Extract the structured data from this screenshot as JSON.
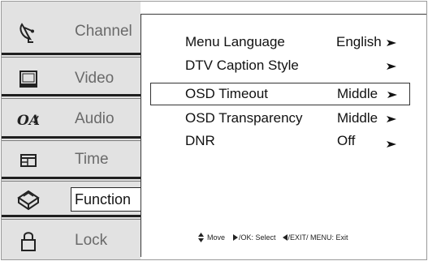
{
  "sidebar": {
    "items": [
      {
        "label": "Channel",
        "icon": "satellite-dish-icon"
      },
      {
        "label": "Video",
        "icon": "monitor-icon"
      },
      {
        "label": "Audio",
        "icon": "audio-icon"
      },
      {
        "label": "Time",
        "icon": "calendar-icon"
      },
      {
        "label": "Function",
        "icon": "toolbox-icon",
        "active": true
      },
      {
        "label": "Lock",
        "icon": "padlock-icon"
      }
    ]
  },
  "menu": {
    "rows": [
      {
        "name": "Menu Language",
        "value": "English"
      },
      {
        "name": "DTV Caption Style",
        "value": ""
      },
      {
        "name": "OSD Timeout",
        "value": "Middle",
        "selected": true
      },
      {
        "name": "OSD Transparency",
        "value": "Middle"
      },
      {
        "name": "DNR",
        "value": "Off"
      }
    ]
  },
  "hint": {
    "move": "Move",
    "ok": "/OK: Select",
    "exit": "/EXIT/ MENU: Exit"
  }
}
